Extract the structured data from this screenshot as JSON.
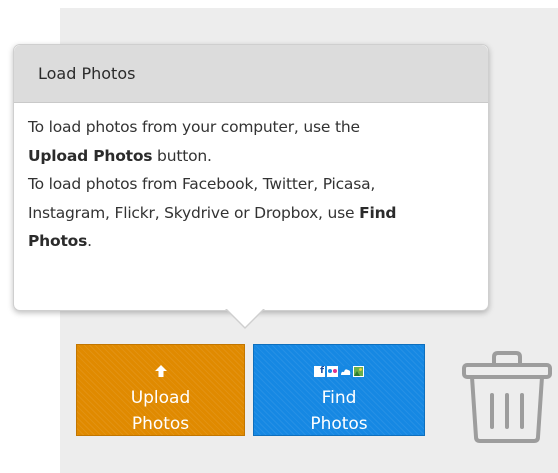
{
  "popover": {
    "title": "Load Photos",
    "line1": "To load photos from your computer, use the",
    "upload_bold": "Upload Photos",
    "line2_rest": " button.",
    "line3": "To load photos from Facebook, Twitter, Picasa,",
    "line4_start": "Instagram, Flickr, Skydrive or Dropbox, use ",
    "find_bold_1": "Find",
    "find_bold_2": "Photos",
    "line5_rest": "."
  },
  "buttons": {
    "upload": {
      "line1": "Upload",
      "line2": "Photos",
      "icon": "upload-arrow-icon",
      "color": "#e08a00"
    },
    "find": {
      "line1": "Find",
      "line2": "Photos",
      "icons": [
        "facebook-icon",
        "flickr-icon",
        "cloud-icon",
        "photo-icon"
      ],
      "facebook_letter": "f",
      "color": "#1688e3"
    }
  },
  "trash": {
    "icon": "trash-icon"
  }
}
